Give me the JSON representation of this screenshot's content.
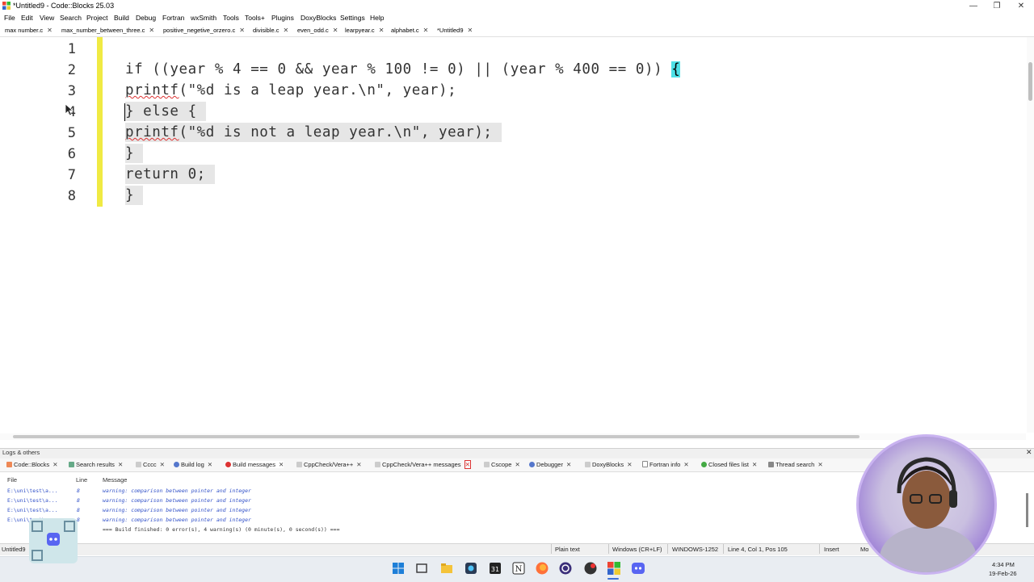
{
  "window": {
    "title": "*Untitled9 - Code::Blocks 25.03",
    "controls": {
      "minimize": "—",
      "maximize": "❐",
      "close": "✕"
    }
  },
  "menu": [
    "File",
    "Edit",
    "View",
    "Search",
    "Project",
    "Build",
    "Debug",
    "Fortran",
    "wxSmith",
    "Tools",
    "Tools+",
    "Plugins",
    "DoxyBlocks",
    "Settings",
    "Help"
  ],
  "file_tabs": [
    {
      "label": "max number.c"
    },
    {
      "label": "max_number_between_three.c"
    },
    {
      "label": "positive_negetive_orzero.c"
    },
    {
      "label": "divisible.c"
    },
    {
      "label": "even_odd.c"
    },
    {
      "label": "learpyear.c"
    },
    {
      "label": "alphabet.c"
    },
    {
      "label": "*Untitled9",
      "active": true
    }
  ],
  "editor": {
    "line_numbers": [
      "1",
      "2",
      "3",
      "4",
      "5",
      "6",
      "7",
      "8"
    ],
    "lines": {
      "l2a": "if ((year % 4 == 0 && year % 100 != 0) || (year % 400 == 0)) ",
      "l2b": "{",
      "l3a": "printf",
      "l3b": "(\"%d is a leap year.\\n\", year);",
      "l4a": "}",
      "l4b": " else { ",
      "l5a": "printf",
      "l5b": "(\"%d is not a leap year.\\n\", year); ",
      "l6": "} ",
      "l7": "return 0; ",
      "l8": "} "
    }
  },
  "logs": {
    "title": "Logs & others",
    "tabs": [
      "Code::Blocks",
      "Search results",
      "Cccc",
      "Build log",
      "Build messages",
      "CppCheck/Vera++",
      "CppCheck/Vera++ messages",
      "Cscope",
      "Debugger",
      "DoxyBlocks",
      "Fortran info",
      "Closed files list",
      "Thread search"
    ],
    "columns": {
      "file": "File",
      "line": "Line",
      "message": "Message"
    },
    "rows": [
      {
        "file": "E:\\uni\\test\\a...",
        "line": "8",
        "message": "warning: comparison between pointer and integer"
      },
      {
        "file": "E:\\uni\\test\\a...",
        "line": "8",
        "message": "warning: comparison between pointer and integer"
      },
      {
        "file": "E:\\uni\\test\\a...",
        "line": "8",
        "message": "warning: comparison between pointer and integer"
      },
      {
        "file": "E:\\uni\\test\\a...",
        "line": "8",
        "message": "warning: comparison between pointer and integer"
      }
    ],
    "summary": "=== Build finished: 0 error(s), 4 warning(s) (0 minute(s), 0 second(s)) ==="
  },
  "status": {
    "file": "Untitled9",
    "lang": "Plain text",
    "eol": "Windows (CR+LF)",
    "encoding": "WINDOWS-1252",
    "position": "Line 4, Col 1, Pos 105",
    "mode": "Insert",
    "extra": "Mo"
  },
  "taskbar": {
    "time": "4:34 PM",
    "date": "19-Feb-26",
    "icons": [
      "windows-start",
      "task-view",
      "file-explorer",
      "snipping-tool",
      "calendar",
      "notion",
      "firefox",
      "obs",
      "discord-like",
      "code-blocks",
      "discord"
    ]
  },
  "colors": {
    "change_bar": "#f0ea43",
    "brace_highlight": "#4fe0e6",
    "selection": "#e6e6e6",
    "warning_text": "#3050c8"
  }
}
